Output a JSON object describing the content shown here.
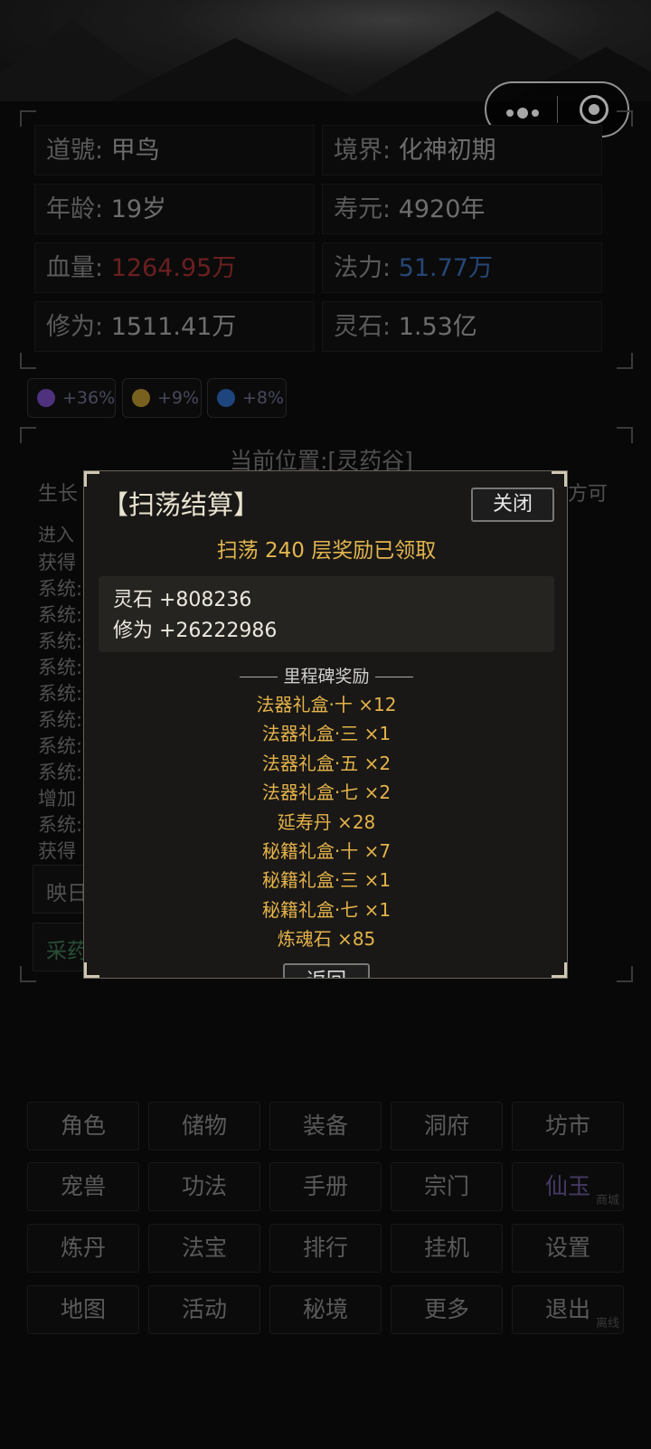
{
  "capsule": {
    "menu_icon": "more-dots-icon",
    "close_icon": "target-circle-icon"
  },
  "stats": [
    {
      "label": "道號: ",
      "value": "甲鸟"
    },
    {
      "label": "境界: ",
      "value": "化神初期"
    },
    {
      "label": "年龄: ",
      "value": "19岁"
    },
    {
      "label": "寿元: ",
      "value": "4920年"
    },
    {
      "label": "血量: ",
      "value": "1264.95万",
      "color": "#a53030"
    },
    {
      "label": "法力: ",
      "value": "51.77万",
      "color": "#3a6db5"
    },
    {
      "label": "修为: ",
      "value": "1511.41万"
    },
    {
      "label": "灵石: ",
      "value": "1.53亿"
    }
  ],
  "buffs": [
    {
      "icon": "purple-orb-icon",
      "text": "+36%",
      "color": "#7a4ec2"
    },
    {
      "icon": "gold-ingot-icon",
      "text": "+9%",
      "color": "#b8952e"
    },
    {
      "icon": "blue-gem-icon",
      "text": "+8%",
      "color": "#2f6ac0"
    }
  ],
  "location": {
    "title": "当前位置:[灵药谷]"
  },
  "background_log": {
    "line_growth": "生长",
    "line_growth_tail": "方可",
    "line_enter": "进入",
    "log_prefixes": [
      "获得",
      "系统:",
      "系统:",
      "系统:",
      "系统:",
      "系统:",
      "系统:",
      "系统:",
      "系统:",
      "增加",
      "系统:",
      "获得"
    ],
    "location_button": "映日",
    "action_button": "采药"
  },
  "menu": [
    {
      "label": "角色"
    },
    {
      "label": "储物"
    },
    {
      "label": "装备"
    },
    {
      "label": "洞府"
    },
    {
      "label": "坊市"
    },
    {
      "label": "宠兽"
    },
    {
      "label": "功法"
    },
    {
      "label": "手册"
    },
    {
      "label": "宗门"
    },
    {
      "label": "仙玉",
      "sub": "商城"
    },
    {
      "label": "炼丹"
    },
    {
      "label": "法宝"
    },
    {
      "label": "排行"
    },
    {
      "label": "挂机"
    },
    {
      "label": "设置"
    },
    {
      "label": "地图"
    },
    {
      "label": "活动"
    },
    {
      "label": "秘境"
    },
    {
      "label": "更多"
    },
    {
      "label": "退出",
      "sub": "离线"
    }
  ],
  "modal": {
    "title": "【扫荡结算】",
    "close_label": "关闭",
    "sweep_text": "扫荡 240 层奖励已领取",
    "rewards": [
      "灵石 +808236",
      "修为 +26222986"
    ],
    "milestone_title": "里程碑奖励",
    "milestones": [
      "法器礼盒·十 ×12",
      "法器礼盒·三 ×1",
      "法器礼盒·五 ×2",
      "法器礼盒·七 ×2",
      "延寿丹 ×28",
      "秘籍礼盒·十 ×7",
      "秘籍礼盒·三 ×1",
      "秘籍礼盒·七 ×1",
      "炼魂石 ×85"
    ],
    "back_label": "返回"
  }
}
